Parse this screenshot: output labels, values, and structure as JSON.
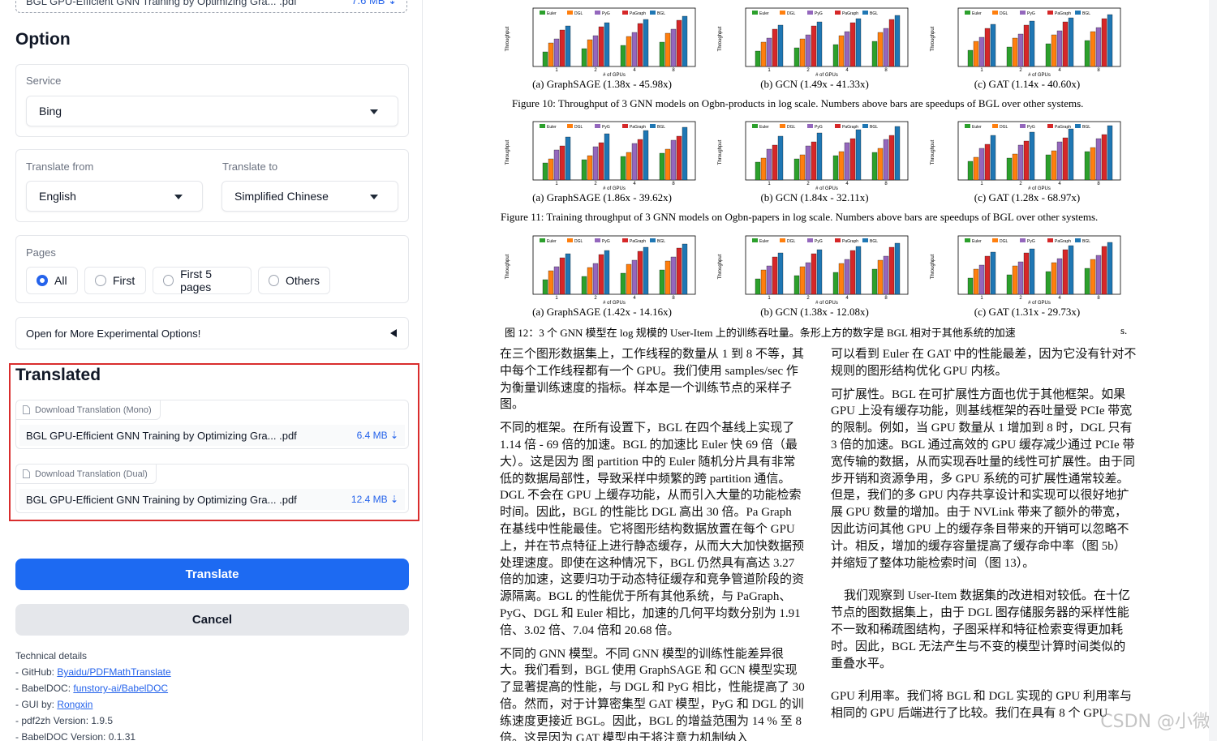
{
  "top_file": {
    "name": "BGL GPU-Efficient GNN Training by Optimizing Gra... .pdf",
    "size": "7.6 MB ⇣"
  },
  "option": {
    "title": "Option",
    "service_label": "Service",
    "service_value": "Bing",
    "translate_from_label": "Translate from",
    "translate_from_value": "English",
    "translate_to_label": "Translate to",
    "translate_to_value": "Simplified Chinese",
    "pages_label": "Pages",
    "pages_options": [
      "All",
      "First",
      "First 5 pages",
      "Others"
    ],
    "pages_selected": "All",
    "more_options": "Open for More Experimental Options!"
  },
  "translated": {
    "title": "Translated",
    "mono_tag": "Download Translation (Mono)",
    "mono_file": "BGL GPU-Efficient GNN Training by Optimizing Gra... .pdf",
    "mono_size": "6.4 MB ⇣",
    "dual_tag": "Download Translation (Dual)",
    "dual_file": "BGL GPU-Efficient GNN Training by Optimizing Gra... .pdf",
    "dual_size": "12.4 MB ⇣"
  },
  "buttons": {
    "translate": "Translate",
    "cancel": "Cancel"
  },
  "tech": {
    "title": "Technical details",
    "github_prefix": "- GitHub: ",
    "github_link": "Byaidu/PDFMathTranslate",
    "babeldoc_prefix": "- BabelDOC: ",
    "babeldoc_link": "funstory-ai/BabelDOC",
    "gui_prefix": "- GUI by: ",
    "gui_link": "Rongxin",
    "pdf2zh_version": "- pdf2zh Version: 1.9.5",
    "babeldoc_version": "- BabelDOC Version: 0.1.31"
  },
  "colors": {
    "accent": "#1d6af2",
    "highlight_border": "#d92d2d",
    "euler": "#2ca02c",
    "dgl": "#ff7f0e",
    "pyg": "#9467bd",
    "pagraph": "#d62728",
    "bgl": "#1f77b4"
  },
  "document": {
    "fig10": {
      "caption": "Figure 10: Throughput of 3 GNN models on Ogbn-products in log scale. Numbers above bars are speedups of BGL over other systems.",
      "panels": [
        "(a) GraphSAGE (1.38x - 45.98x)",
        "(b) GCN (1.49x - 41.33x)",
        "(c) GAT (1.14x - 40.60x)"
      ]
    },
    "fig11": {
      "caption": "Figure 11: Training throughput of 3 GNN models on Ogbn-papers in log scale. Numbers above bars are speedups of BGL over other systems.",
      "panels": [
        "(a) GraphSAGE (1.86x - 39.62x)",
        "(b) GCN (1.84x - 32.11x)",
        "(c) GAT (1.28x - 68.97x)"
      ]
    },
    "fig12": {
      "caption": "图 12：3 个 GNN 模型在 log 规模的 User-Item 上的训练吞吐量。条形上方的数字是 BGL 相对于其他系统的加速",
      "caption_tail": "s.",
      "panels": [
        "(a) GraphSAGE (1.42x - 14.16x)",
        "(b) GCN (1.38x - 12.08x)",
        "(c) GAT (1.31x - 29.73x)"
      ]
    },
    "axis_label": "Throughput\n(Thousand samples/sec)",
    "x_label": "# of GPUs",
    "legend": [
      "Euler",
      "DGL",
      "PyG",
      "PaGraph",
      "BGL"
    ],
    "left_col": [
      "在三个图形数据集上，工作线程的数量从 1 到 8 不等，其中每个工作线程都有一个 GPU。我们使用 samples/sec 作为衡量训练速度的指标。样本是一个训练节点的采样子图。",
      "不同的框架。在所有设置下，BGL 在四个基线上实现了 1.14 倍 - 69 倍的加速。BGL 的加速比 Euler 快 69 倍（最大）。这是因为 图 partition 中的 Euler 随机分片具有非常低的数据局部性，导致采样中频繁的跨 partition 通信。DGL 不会在 GPU 上缓存功能，从而引入大量的功能检索时间。因此，BGL 的性能比 DGL 高出 30 倍。Pa Graph 在基线中性能最佳。它将图形结构数据放置在每个 GPU 上，并在节点特征上进行静态缓存，从而大大加快数据预处理速度。即使在这种情况下，BGL 仍然具有高达 3.27 倍的加速，这要归功于动态特征缓存和竞争管道阶段的资源隔离。BGL 的性能优于所有其他系统，与 PaGraph、PyG、DGL 和 Euler 相比，加速的几何平均数分别为 1.91 倍、3.02 倍、7.04 倍和 20.68 倍。",
      "不同的 GNN 模型。不同 GNN 模型的训练性能差异很大。我们看到，BGL 使用 GraphSAGE 和 GCN 模型实现了显著提高的性能，与 DGL 和 PyG 相比，性能提高了 30 倍。然而，对于计算密集型 GAT 模型，PyG 和 DGL 的训练速度更接近 BGL。因此，BGL 的增益范围为 14 % 至 8 倍。这是因为 GAT 模型由于将注意力机制纳入"
    ],
    "right_col": [
      "可以看到 Euler 在 GAT 中的性能最差，因为它没有针对不规则的图形结构优化 GPU 内核。",
      "可扩展性。BGL 在可扩展性方面也优于其他框架。如果 GPU 上没有缓存功能，则基线框架的吞吐量受 PCIe 带宽的限制。例如，当 GPU 数量从 1 增加到 8 时，DGL 只有 3 倍的加速。BGL 通过高效的 GPU 缓存减少通过 PCIe 带宽传输的数据，从而实现吞吐量的线性可扩展性。由于同步开销和资源争用，多 GPU 系统的可扩展性通常较差。但是，我们的多 GPU 内存共享设计和实现可以很好地扩展 GPU 数量的增加。由于 NVLink 带来了额外的带宽，因此访问其他 GPU 上的缓存条目带来的开销可以忽略不计。相反，增加的缓存容量提高了缓存命中率（图 5b）并缩短了整体功能检索时间（图 13）。",
      "我们观察到 User-Item 数据集的改进相对较低。在十亿节点的图数据集上，由于 DGL 图存储服务器的采样性能不一致和稀疏图结构，子图采样和特征检索变得更加耗时。因此，BGL 无法产生与不变的模型计算时间类似的重叠水平。",
      "GPU 利用率。我们将 BGL 和 DGL 实现的 GPU 利用率与相同的 GPU 后端进行了比较。我们在具有 8 个 GPU"
    ],
    "watermark": "CSDN @小微"
  }
}
